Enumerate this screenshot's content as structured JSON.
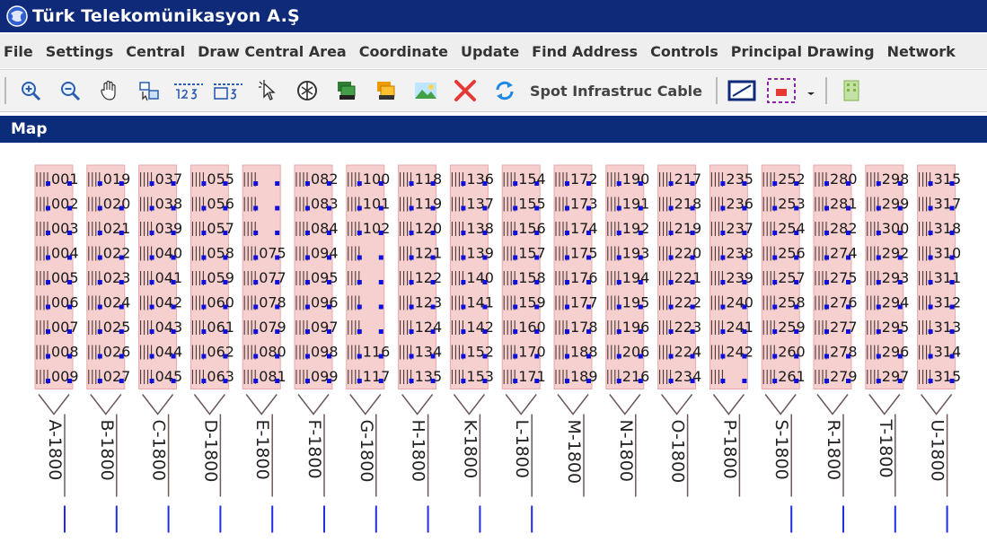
{
  "window": {
    "title": "Türk Telekomünikasyon A.Ş"
  },
  "menu": [
    "File",
    "Settings",
    "Central",
    "Draw Central Area",
    "Coordinate",
    "Update",
    "Find Address",
    "Controls",
    "Principal Drawing",
    "Network"
  ],
  "toolbar": {
    "buttons": [
      {
        "name": "zoom-in-icon"
      },
      {
        "name": "zoom-out-icon"
      },
      {
        "name": "pan-hand-icon"
      },
      {
        "name": "identify-icon"
      },
      {
        "name": "numbering-icon"
      },
      {
        "name": "numbering-selection-icon"
      },
      {
        "name": "pointer-select-icon"
      },
      {
        "name": "network-icon"
      },
      {
        "name": "layers-green-icon"
      },
      {
        "name": "layers-orange-icon"
      },
      {
        "name": "landscape-image-icon"
      },
      {
        "name": "delete-x-icon"
      },
      {
        "name": "refresh-arrows-icon"
      }
    ],
    "spot_label": "Spot Infrastruc Cable",
    "buttons2": [
      {
        "name": "rectangle-draw-icon"
      },
      {
        "name": "selection-frame-icon"
      },
      {
        "name": "dropdown-arrow-icon"
      },
      {
        "name": "building-icon"
      }
    ]
  },
  "map_panel": {
    "title": "Map"
  },
  "map": {
    "cables": [
      {
        "label": "A-1800",
        "pairs": [
          "001",
          "002",
          "003",
          "004",
          "005",
          "006",
          "007",
          "008",
          "009"
        ]
      },
      {
        "label": "B-1800",
        "pairs": [
          "019",
          "020",
          "021",
          "022",
          "023",
          "024",
          "025",
          "026",
          "027"
        ]
      },
      {
        "label": "C-1800",
        "pairs": [
          "037",
          "038",
          "039",
          "040",
          "041",
          "042",
          "043",
          "044",
          "045"
        ]
      },
      {
        "label": "D-1800",
        "pairs": [
          "055",
          "056",
          "057",
          "058",
          "059",
          "060",
          "061",
          "062",
          "063"
        ]
      },
      {
        "label": "E-1800",
        "pairs": [
          "",
          "",
          "",
          "075",
          "077",
          "078",
          "079",
          "080",
          "081"
        ]
      },
      {
        "label": "F-1800",
        "pairs": [
          "082",
          "083",
          "084",
          "094",
          "095",
          "096",
          "097",
          "098",
          "099"
        ]
      },
      {
        "label": "G-1800",
        "pairs": [
          "100",
          "101",
          "102",
          "",
          "",
          "",
          "",
          "116",
          "117"
        ]
      },
      {
        "label": "H-1800",
        "pairs": [
          "118",
          "119",
          "120",
          "121",
          "122",
          "123",
          "124",
          "134",
          "135"
        ]
      },
      {
        "label": "K-1800",
        "pairs": [
          "136",
          "137",
          "138",
          "139",
          "140",
          "141",
          "142",
          "152",
          "153"
        ]
      },
      {
        "label": "L-1800",
        "pairs": [
          "154",
          "155",
          "156",
          "157",
          "158",
          "159",
          "160",
          "170",
          "171"
        ]
      },
      {
        "label": "M-1800",
        "pairs": [
          "172",
          "173",
          "174",
          "175",
          "176",
          "177",
          "178",
          "188",
          "189"
        ]
      },
      {
        "label": "N-1800",
        "pairs": [
          "190",
          "191",
          "192",
          "193",
          "194",
          "195",
          "196",
          "206",
          "216"
        ]
      },
      {
        "label": "O-1800",
        "pairs": [
          "217",
          "218",
          "219",
          "220",
          "221",
          "222",
          "223",
          "224",
          "234"
        ]
      },
      {
        "label": "P-1800",
        "pairs": [
          "235",
          "236",
          "237",
          "238",
          "239",
          "240",
          "241",
          "242",
          ""
        ]
      },
      {
        "label": "S-1800",
        "pairs": [
          "252",
          "253",
          "254",
          "256",
          "257",
          "258",
          "259",
          "260",
          "261"
        ]
      },
      {
        "label": "R-1800",
        "pairs": [
          "280",
          "281",
          "282",
          "274",
          "275",
          "276",
          "277",
          "278",
          "279"
        ]
      },
      {
        "label": "T-1800",
        "pairs": [
          "298",
          "299",
          "300",
          "292",
          "293",
          "294",
          "295",
          "296",
          "297"
        ]
      },
      {
        "label": "U-1800",
        "pairs": [
          "315",
          "317",
          "318",
          "310",
          "311",
          "312",
          "313",
          "314",
          "315"
        ]
      }
    ],
    "colors": {
      "fill": "#f6cfcf",
      "stroke": "#e8a9a9",
      "dot": "#1010dd",
      "text": "#1a1a1a",
      "wire": "#1e2ee0",
      "line": "#6b5a5a"
    }
  }
}
